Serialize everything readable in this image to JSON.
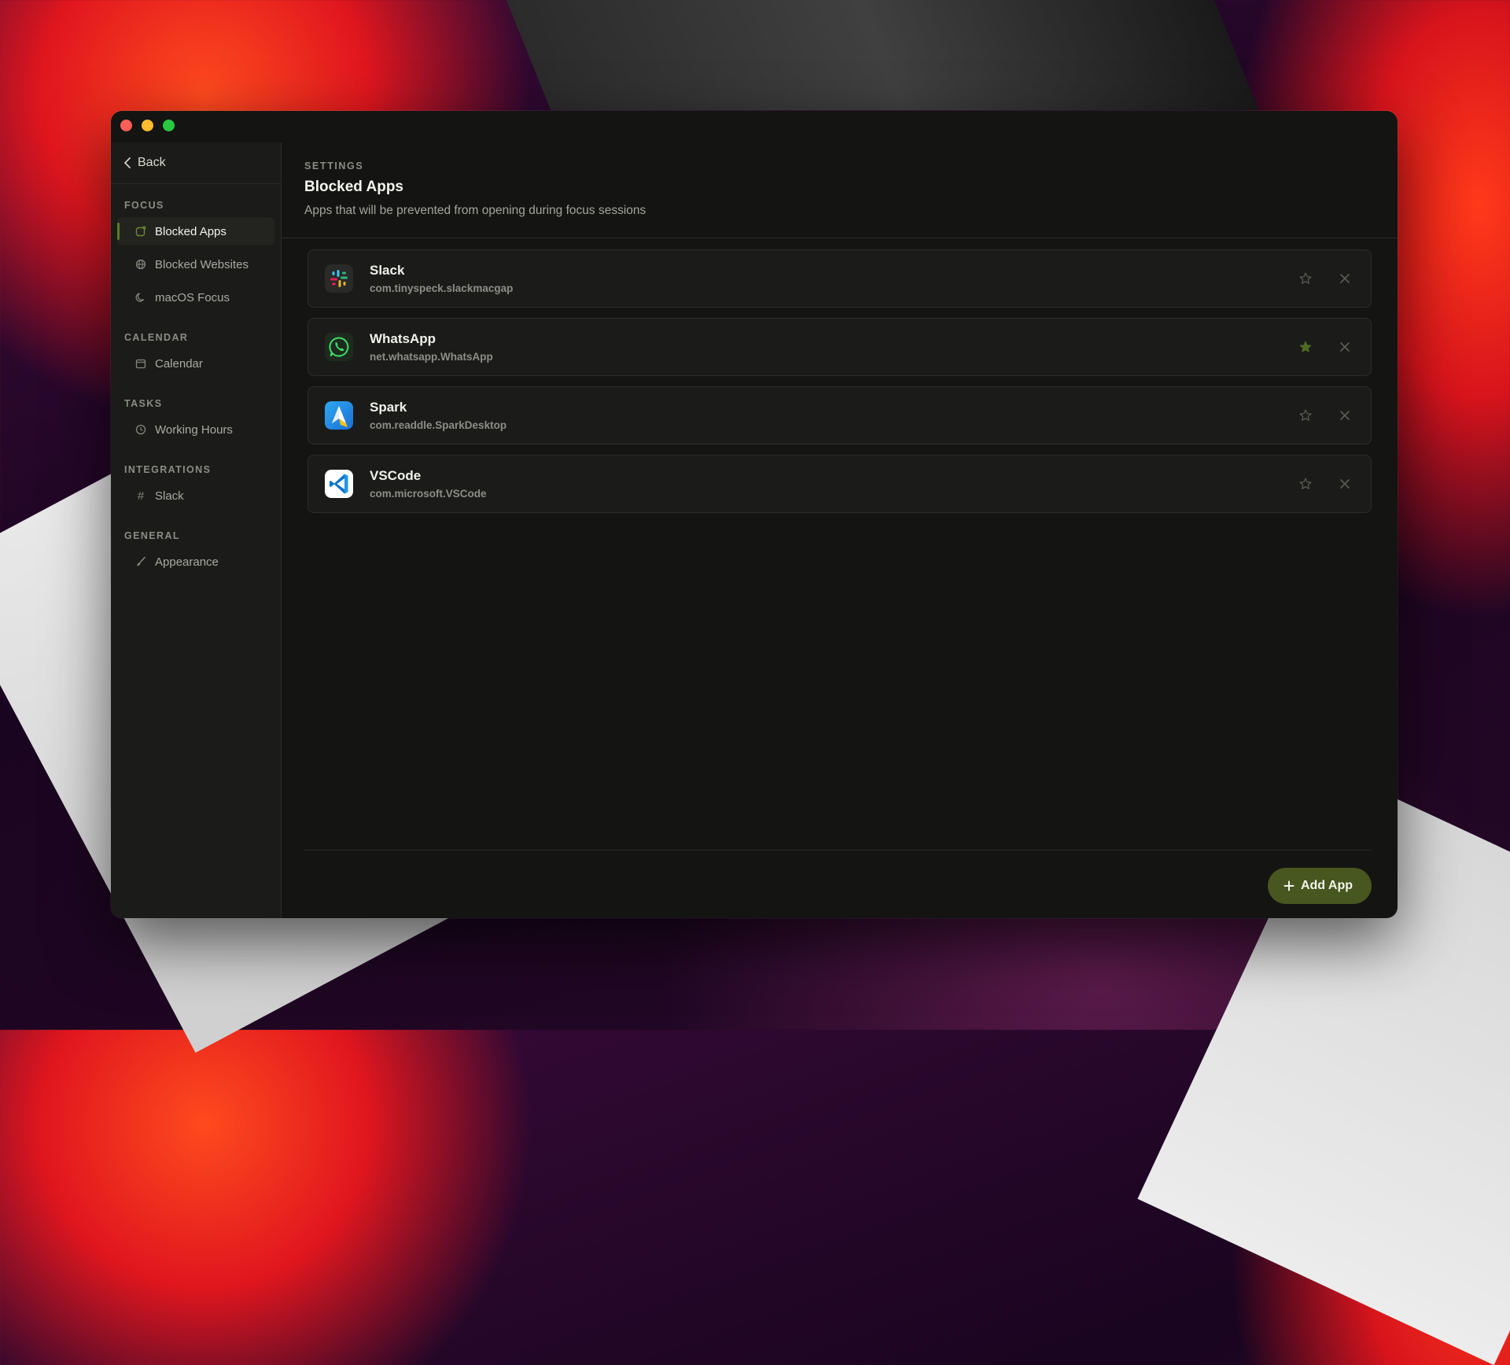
{
  "window": {
    "controls": [
      "close",
      "minimize",
      "maximize"
    ]
  },
  "sidebar": {
    "back_label": "Back",
    "sections": [
      {
        "title": "FOCUS",
        "items": [
          {
            "label": "Blocked Apps",
            "icon": "app-icon",
            "active": true
          },
          {
            "label": "Blocked Websites",
            "icon": "globe-icon"
          },
          {
            "label": "macOS Focus",
            "icon": "moon-icon"
          }
        ]
      },
      {
        "title": "CALENDAR",
        "items": [
          {
            "label": "Calendar",
            "icon": "calendar-icon"
          }
        ]
      },
      {
        "title": "TASKS",
        "items": [
          {
            "label": "Working Hours",
            "icon": "clock-icon"
          }
        ]
      },
      {
        "title": "INTEGRATIONS",
        "items": [
          {
            "label": "Slack",
            "icon": "hash-icon"
          }
        ]
      },
      {
        "title": "GENERAL",
        "items": [
          {
            "label": "Appearance",
            "icon": "paintbrush-icon"
          }
        ]
      }
    ]
  },
  "header": {
    "eyebrow": "SETTINGS",
    "title": "Blocked Apps",
    "subtitle": "Apps that will be prevented from opening during focus sessions"
  },
  "apps": [
    {
      "name": "Slack",
      "bundle": "com.tinyspeck.slackmacgap",
      "icon": "slack-logo-icon",
      "starred": false
    },
    {
      "name": "WhatsApp",
      "bundle": "net.whatsapp.WhatsApp",
      "icon": "whatsapp-logo-icon",
      "starred": true
    },
    {
      "name": "Spark",
      "bundle": "com.readdle.SparkDesktop",
      "icon": "spark-logo-icon",
      "starred": false
    },
    {
      "name": "VSCode",
      "bundle": "com.microsoft.VSCode",
      "icon": "vscode-logo-icon",
      "starred": false
    }
  ],
  "footer": {
    "add_label": "Add App"
  },
  "colors": {
    "accent": "#48561f",
    "active_marker": "#5d7a2a",
    "star_active": "#4e6a22"
  }
}
